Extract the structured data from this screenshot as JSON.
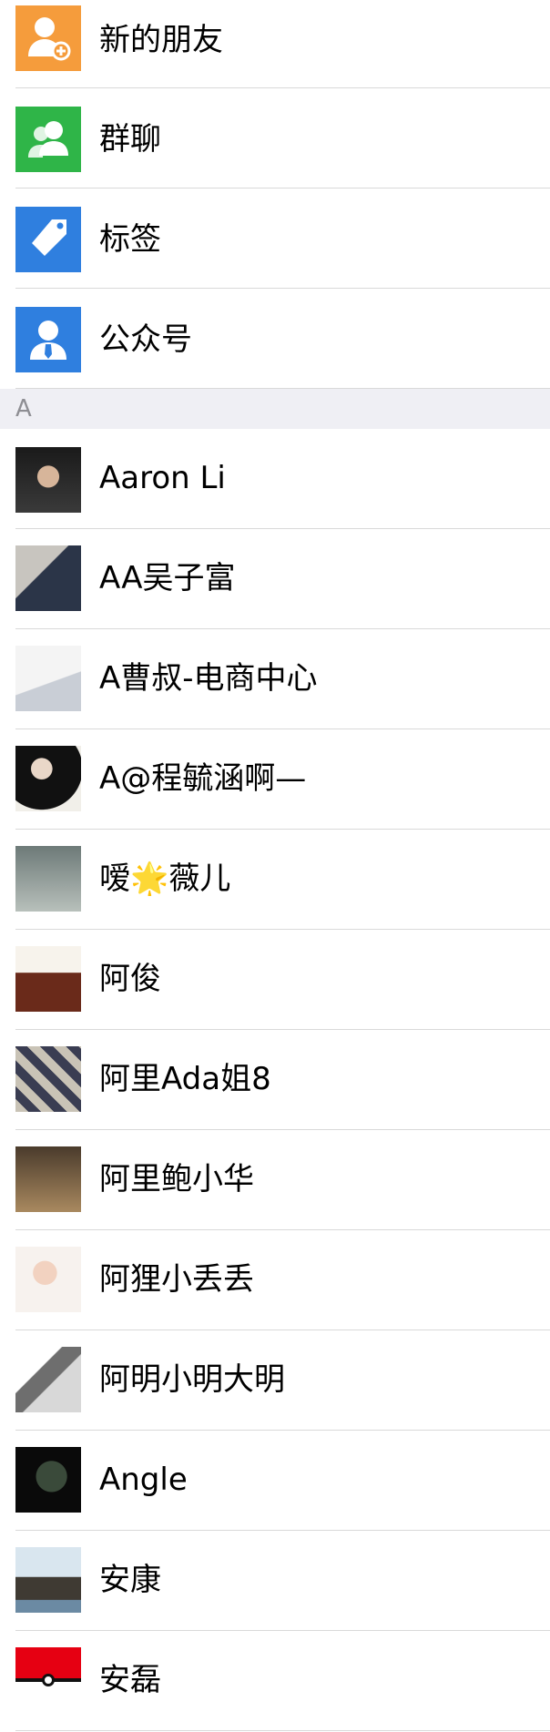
{
  "top_items": [
    {
      "label": "新的朋友",
      "icon": "add-friend-icon",
      "color": "#f59c3c"
    },
    {
      "label": "群聊",
      "icon": "group-chat-icon",
      "color": "#2fb548"
    },
    {
      "label": "标签",
      "icon": "tag-icon",
      "color": "#2f7fdf"
    },
    {
      "label": "公众号",
      "icon": "official-account-icon",
      "color": "#2f7fdf"
    }
  ],
  "section_letter": "A",
  "contacts": [
    {
      "name": "Aaron Li"
    },
    {
      "name": "AA吴子富"
    },
    {
      "name": "A曹叔-电商中心"
    },
    {
      "name": "A@程毓涵啊—"
    },
    {
      "name": "嗳🌟薇儿"
    },
    {
      "name": "阿俊"
    },
    {
      "name": "阿里Ada姐8"
    },
    {
      "name": "阿里鲍小华"
    },
    {
      "name": "阿狸小丢丢"
    },
    {
      "name": "阿明小明大明"
    },
    {
      "name": "Angle"
    },
    {
      "name": "安康"
    },
    {
      "name": "安磊"
    }
  ]
}
